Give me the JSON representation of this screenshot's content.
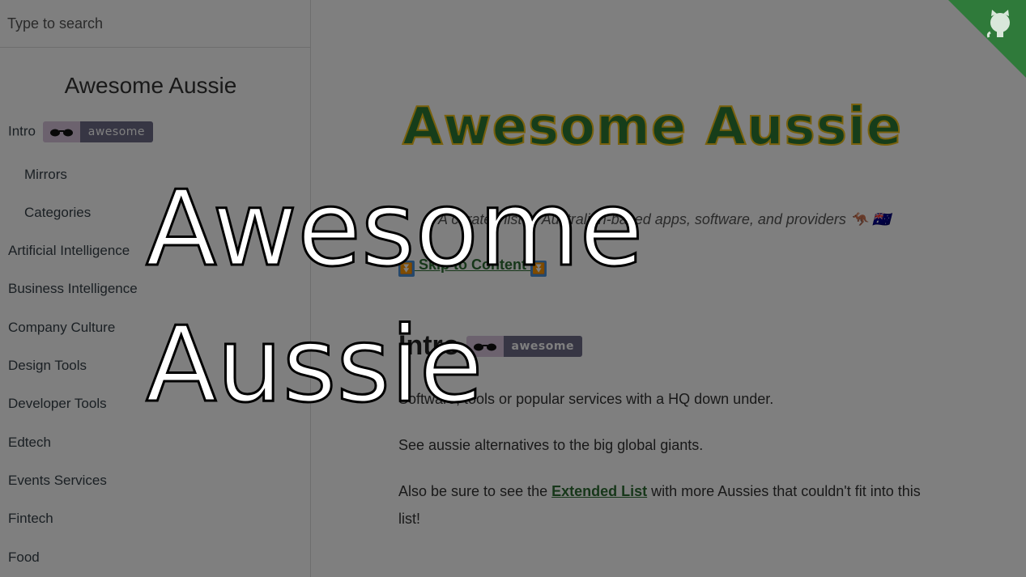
{
  "search": {
    "placeholder": "Type to search"
  },
  "sidebar": {
    "title": "Awesome Aussie",
    "badge_text": "awesome",
    "items": [
      {
        "label": "Intro"
      },
      {
        "label": "Mirrors"
      },
      {
        "label": "Categories"
      },
      {
        "label": "Artificial Intelligence"
      },
      {
        "label": "Business Intelligence"
      },
      {
        "label": "Company Culture"
      },
      {
        "label": "Design Tools"
      },
      {
        "label": "Developer Tools"
      },
      {
        "label": "Edtech"
      },
      {
        "label": "Events Services"
      },
      {
        "label": "Fintech"
      },
      {
        "label": "Food"
      }
    ]
  },
  "main": {
    "title": "Awesome Aussie",
    "subtitle": "A curated list of Australian-based apps, software, and providers",
    "subtitle_emoji": "🦘 🇦🇺",
    "skip_link": "Skip to Content",
    "skip_icon": "⏬",
    "intro_heading": "Intro",
    "badge_text": "awesome",
    "paragraphs": {
      "p1": "Software, tools or popular services with a HQ down under.",
      "p2": "See aussie alternatives to the big global giants.",
      "p3_before": "Also be sure to see the ",
      "p3_link": "Extended List",
      "p3_after": " with more Aussies that couldn't fit into this list!"
    }
  },
  "overlay": {
    "title": "Awesome\nAussie"
  },
  "colors": {
    "title_fill": "#2d7a35",
    "title_stroke": "#f2c31a",
    "link": "#2f6e34",
    "corner": "#2f7a3a"
  }
}
